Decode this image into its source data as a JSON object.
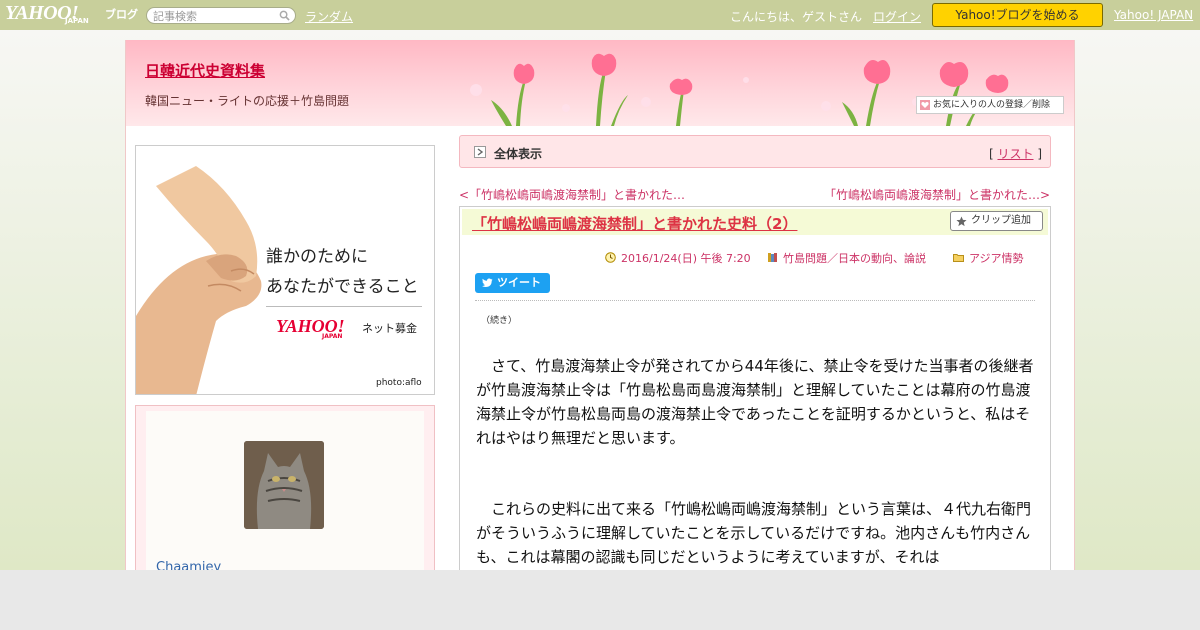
{
  "topbar": {
    "logo_main": "YAHOO!",
    "logo_sub": "JAPAN",
    "logo_blog": "ブログ",
    "search_placeholder": "記事検索",
    "random_label": "ランダム",
    "greeting": "こんにちは、ゲストさん",
    "login_label": "ログイン",
    "start_button": "Yahoo!ブログを始める",
    "yahoo_japan_link": "Yahoo! JAPAN"
  },
  "header": {
    "blog_title": "日韓近代史資料集",
    "blog_description": "韓国ニュー・ライトの応援＋竹島問題",
    "favorite_button": "お気に入りの人の登録／削除"
  },
  "ad": {
    "line1": "誰かのために",
    "line2": "あなたができること",
    "logo": "YAHOO!",
    "logo_sub": "JAPAN",
    "service": "ネット募金",
    "credit": "photo:aflo"
  },
  "profile": {
    "name": "Chaamiey"
  },
  "nav": {
    "bar_title": "全体表示",
    "list_prefix": "[ ",
    "list_label": "リスト",
    "list_suffix": " ]",
    "prev_link": "<「竹嶋松嶋両嶋渡海禁制」と書かれた…",
    "next_link": "「竹嶋松嶋両嶋渡海禁制」と書かれた…>"
  },
  "article": {
    "title": "「竹嶋松嶋両嶋渡海禁制」と書かれた史料（2）",
    "clip_button": "クリップ追加",
    "date": "2016/1/24(日) 午後 7:20",
    "category1": "竹島問題／日本の動向、論説",
    "category2": "アジア情勢",
    "tweet_button": "ツイート",
    "continued": "（続き）",
    "paragraph1": "　さて、竹島渡海禁止令が発されてから44年後に、禁止令を受けた当事者の後継者が竹島渡海禁止令は「竹島松島両島渡海禁制」と理解していたことは幕府の竹島渡海禁止令が竹島松島両島の渡海禁止令であったことを証明するかというと、私はそれはやはり無理だと思います。",
    "paragraph2": "　これらの史料に出て来る「竹嶋松嶋両嶋渡海禁制」という言葉は、４代九右衛門がそういうふうに理解していたことを示しているだけですね。池内さんも竹内さんも、これは幕閣の認識も同じだというように考えていますが、それは"
  },
  "colors": {
    "topbar": "#c8cf9b",
    "accent": "#cc3366",
    "title_red": "#dd3344",
    "start_button": "#ffd200",
    "tweet": "#1da1f2"
  }
}
